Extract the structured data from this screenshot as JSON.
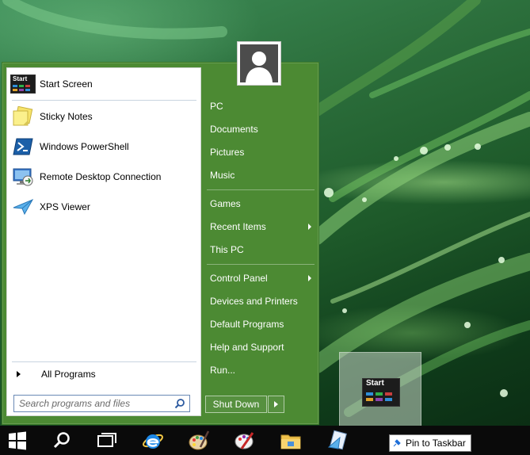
{
  "programs": [
    {
      "label": "Start Screen",
      "icon": "start-screen-icon"
    },
    {
      "label": "Sticky Notes",
      "icon": "sticky-notes-icon"
    },
    {
      "label": "Windows PowerShell",
      "icon": "powershell-icon"
    },
    {
      "label": "Remote Desktop Connection",
      "icon": "remote-desktop-icon"
    },
    {
      "label": "XPS Viewer",
      "icon": "xps-viewer-icon"
    }
  ],
  "tile_text": "Start",
  "all_programs_label": "All Programs",
  "search": {
    "placeholder": "Search programs and files"
  },
  "right_items": {
    "pc": "PC",
    "documents": "Documents",
    "pictures": "Pictures",
    "music": "Music",
    "games": "Games",
    "recent_items": "Recent Items",
    "this_pc": "This PC",
    "control_panel": "Control Panel",
    "devices_printers": "Devices and Printers",
    "default_programs": "Default Programs",
    "help_support": "Help and Support",
    "run": "Run..."
  },
  "shutdown_label": "Shut Down",
  "drag_tile_text": "Start",
  "tooltip_label": "Pin to Taskbar",
  "taskbar_icons": [
    "windows-start-icon",
    "search-icon",
    "task-view-icon",
    "internet-explorer-icon",
    "paint-icon",
    "paint-palette-icon",
    "file-explorer-icon",
    "xps-document-icon"
  ],
  "colors": {
    "menu_green": "#4c8a33",
    "taskbar": "#0a0a0a"
  }
}
